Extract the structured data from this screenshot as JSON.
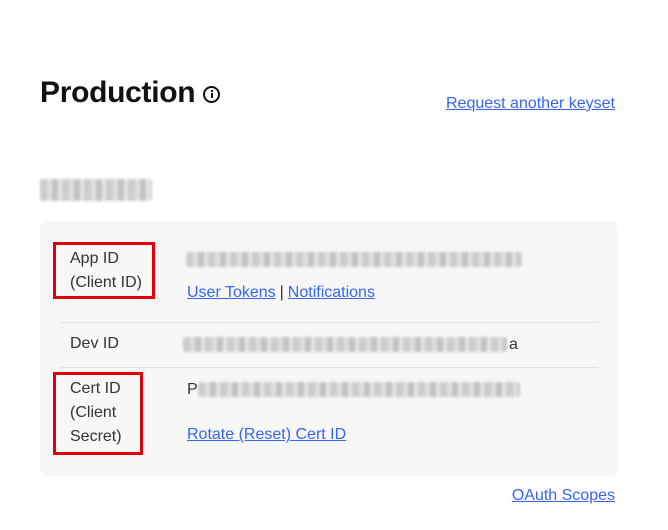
{
  "header": {
    "title": "Production",
    "request_link": "Request another keyset"
  },
  "keyset": {
    "name_redacted": true
  },
  "credentials": {
    "app_id": {
      "label_line1": "App ID",
      "label_line2": "(Client ID)",
      "links": {
        "user_tokens": "User Tokens",
        "separator": "|",
        "notifications": "Notifications"
      }
    },
    "dev_id": {
      "label": "Dev ID",
      "value_suffix": "a"
    },
    "cert_id": {
      "label_line1": "Cert ID",
      "label_line2": "(Client",
      "label_line3": "Secret)",
      "value_prefix": "P",
      "rotate_link": "Rotate (Reset) Cert ID"
    }
  },
  "footer": {
    "oauth_link": "OAuth Scopes"
  },
  "colors": {
    "link": "#3665f3",
    "highlight_box": "#e0000b",
    "card_background": "#f7f7f7"
  },
  "icons": {
    "title_icon": "info-icon"
  }
}
